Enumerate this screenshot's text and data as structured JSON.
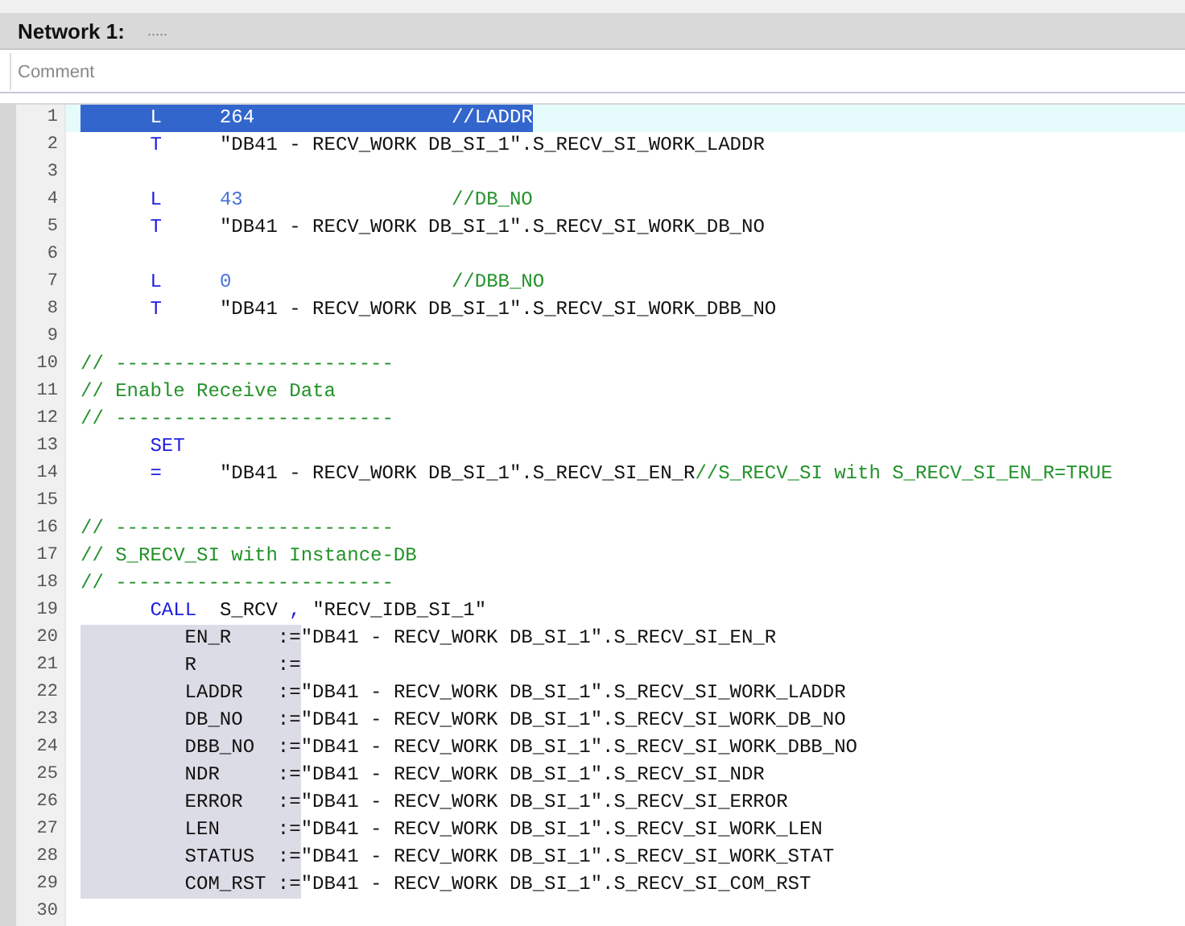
{
  "network": {
    "title": "Network 1:",
    "dots": "....."
  },
  "comment": {
    "placeholder": "Comment"
  },
  "lines": [
    {
      "number": "1",
      "current": true,
      "segments": [
        {
          "text": "      L     ",
          "kind": "keyword",
          "selected": true
        },
        {
          "text": "264                 ",
          "kind": "number",
          "selected": true
        },
        {
          "text": "//LADDR",
          "kind": "comment",
          "selected": true
        }
      ]
    },
    {
      "number": "2",
      "current": false,
      "segments": [
        {
          "text": "      T     ",
          "kind": "keyword"
        },
        {
          "text": "\"DB41 - RECV_WORK DB_SI_1\".S_RECV_SI_WORK_LADDR",
          "kind": "text"
        }
      ]
    },
    {
      "number": "3",
      "current": false
    },
    {
      "number": "4",
      "current": false,
      "segments": [
        {
          "text": "      L     ",
          "kind": "keyword"
        },
        {
          "text": "43                  ",
          "kind": "number"
        },
        {
          "text": "//DB_NO",
          "kind": "comment"
        }
      ]
    },
    {
      "number": "5",
      "current": false,
      "segments": [
        {
          "text": "      T     ",
          "kind": "keyword"
        },
        {
          "text": "\"DB41 - RECV_WORK DB_SI_1\".S_RECV_SI_WORK_DB_NO",
          "kind": "text"
        }
      ]
    },
    {
      "number": "6",
      "current": false
    },
    {
      "number": "7",
      "current": false,
      "segments": [
        {
          "text": "      L     ",
          "kind": "keyword"
        },
        {
          "text": "0                   ",
          "kind": "number"
        },
        {
          "text": "//DBB_NO",
          "kind": "comment"
        }
      ]
    },
    {
      "number": "8",
      "current": false,
      "segments": [
        {
          "text": "      T     ",
          "kind": "keyword"
        },
        {
          "text": "\"DB41 - RECV_WORK DB_SI_1\".S_RECV_SI_WORK_DBB_NO",
          "kind": "text"
        }
      ]
    },
    {
      "number": "9",
      "current": false
    },
    {
      "number": "10",
      "current": false,
      "segments": [
        {
          "text": "// ------------------------",
          "kind": "comment"
        }
      ]
    },
    {
      "number": "11",
      "current": false,
      "segments": [
        {
          "text": "// Enable Receive Data",
          "kind": "comment"
        }
      ]
    },
    {
      "number": "12",
      "current": false,
      "segments": [
        {
          "text": "// ------------------------",
          "kind": "comment"
        }
      ]
    },
    {
      "number": "13",
      "current": false,
      "segments": [
        {
          "text": "      SET",
          "kind": "keyword"
        }
      ]
    },
    {
      "number": "14",
      "current": false,
      "segments": [
        {
          "text": "      =     ",
          "kind": "keyword"
        },
        {
          "text": "\"DB41 - RECV_WORK DB_SI_1\".S_RECV_SI_EN_R",
          "kind": "text"
        },
        {
          "text": "//S_RECV_SI with S_RECV_SI_EN_R=TRUE",
          "kind": "comment"
        }
      ]
    },
    {
      "number": "15",
      "current": false
    },
    {
      "number": "16",
      "current": false,
      "segments": [
        {
          "text": "// ------------------------",
          "kind": "comment"
        }
      ]
    },
    {
      "number": "17",
      "current": false,
      "segments": [
        {
          "text": "// S_RECV_SI with Instance-DB",
          "kind": "comment"
        }
      ]
    },
    {
      "number": "18",
      "current": false,
      "segments": [
        {
          "text": "// ------------------------",
          "kind": "comment"
        }
      ]
    },
    {
      "number": "19",
      "current": false,
      "segments": [
        {
          "text": "      CALL",
          "kind": "keyword"
        },
        {
          "text": "  S_RCV ",
          "kind": "text"
        },
        {
          "text": ",",
          "kind": "keyword"
        },
        {
          "text": " \"RECV_IDB_SI_1\"",
          "kind": "text"
        }
      ]
    },
    {
      "number": "20",
      "current": false,
      "segments": [
        {
          "text": "         EN_R    :=",
          "kind": "param"
        },
        {
          "text": "\"DB41 - RECV_WORK DB_SI_1\".S_RECV_SI_EN_R",
          "kind": "text"
        }
      ]
    },
    {
      "number": "21",
      "current": false,
      "segments": [
        {
          "text": "         R       :=",
          "kind": "param"
        }
      ]
    },
    {
      "number": "22",
      "current": false,
      "segments": [
        {
          "text": "         LADDR   :=",
          "kind": "param"
        },
        {
          "text": "\"DB41 - RECV_WORK DB_SI_1\".S_RECV_SI_WORK_LADDR",
          "kind": "text"
        }
      ]
    },
    {
      "number": "23",
      "current": false,
      "segments": [
        {
          "text": "         DB_NO   :=",
          "kind": "param"
        },
        {
          "text": "\"DB41 - RECV_WORK DB_SI_1\".S_RECV_SI_WORK_DB_NO",
          "kind": "text"
        }
      ]
    },
    {
      "number": "24",
      "current": false,
      "segments": [
        {
          "text": "         DBB_NO  :=",
          "kind": "param"
        },
        {
          "text": "\"DB41 - RECV_WORK DB_SI_1\".S_RECV_SI_WORK_DBB_NO",
          "kind": "text"
        }
      ]
    },
    {
      "number": "25",
      "current": false,
      "segments": [
        {
          "text": "         NDR     :=",
          "kind": "param"
        },
        {
          "text": "\"DB41 - RECV_WORK DB_SI_1\".S_RECV_SI_NDR",
          "kind": "text"
        }
      ]
    },
    {
      "number": "26",
      "current": false,
      "segments": [
        {
          "text": "         ERROR   :=",
          "kind": "param"
        },
        {
          "text": "\"DB41 - RECV_WORK DB_SI_1\".S_RECV_SI_ERROR",
          "kind": "text"
        }
      ]
    },
    {
      "number": "27",
      "current": false,
      "segments": [
        {
          "text": "         LEN     :=",
          "kind": "param"
        },
        {
          "text": "\"DB41 - RECV_WORK DB_SI_1\".S_RECV_SI_WORK_LEN",
          "kind": "text"
        }
      ]
    },
    {
      "number": "28",
      "current": false,
      "segments": [
        {
          "text": "         STATUS  :=",
          "kind": "param"
        },
        {
          "text": "\"DB41 - RECV_WORK DB_SI_1\".S_RECV_SI_WORK_STAT",
          "kind": "text"
        }
      ]
    },
    {
      "number": "29",
      "current": false,
      "segments": [
        {
          "text": "         COM_RST :=",
          "kind": "param"
        },
        {
          "text": "\"DB41 - RECV_WORK DB_SI_1\".S_RECV_SI_COM_RST",
          "kind": "text"
        }
      ]
    },
    {
      "number": "30",
      "current": false
    }
  ]
}
